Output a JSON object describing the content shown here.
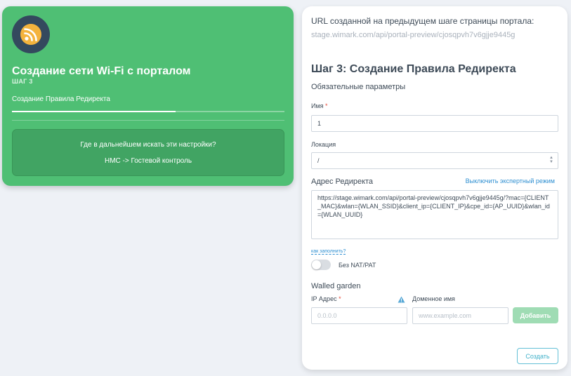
{
  "wizard": {
    "title": "Создание сети Wi-Fi с порталом",
    "step": "ШАГ 3",
    "substep": "Создание Правила Редиректа",
    "progress": 0.6,
    "info_question": "Где в дальнейшем искать эти настройки?",
    "info_answer": "НМС -> Гостевой контроль",
    "logo_icon": "wifi-icon"
  },
  "form": {
    "url_label": "URL созданной на предыдущем шаге страницы портала:",
    "url_value": "stage.wimark.com/api/portal-preview/cjosqpvh7v6gjje9445g",
    "heading": "Шаг 3: Создание Правила Редиректа",
    "required_params": "Обязательные параметры",
    "name_label": "Имя",
    "name_value": "1",
    "location_label": "Локация",
    "location_value": "/",
    "redirect_label": "Адрес Редиректа",
    "expert_link": "Выключить экспертный режим",
    "redirect_value": "https://stage.wimark.com/api/portal-preview/cjosqpvh7v6gjje9445g/?mac={CLIENT_MAC}&wlan={WLAN_SSID}&client_ip={CLIENT_IP}&cpe_id={AP_UUID}&wlan_id={WLAN_UUID}",
    "how_to_fill": "как заполнить?",
    "nat_label": "Без NAT/PAT",
    "nat_enabled": false,
    "walled_garden": "Walled garden",
    "ip_label": "IP Адрес",
    "ip_placeholder": "0.0.0.0",
    "domain_label": "Доменное имя",
    "domain_placeholder": "www.example.com",
    "add_button": "Добавить",
    "create_button": "Создать",
    "required_mark": "*"
  },
  "colors": {
    "green": "#4fbf74",
    "link": "#2e8fd1",
    "required": "#e74c3c"
  }
}
